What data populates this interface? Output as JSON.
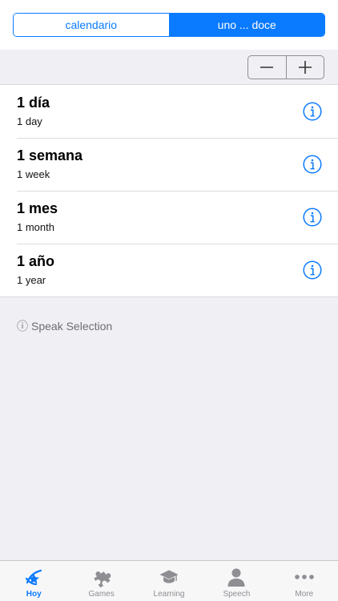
{
  "segmented": {
    "left_label": "calendario",
    "right_label": "uno ... doce",
    "selected": "right"
  },
  "stepper": {
    "minus": "−",
    "plus": "+"
  },
  "list": [
    {
      "title": "1 día",
      "subtitle": "1 day"
    },
    {
      "title": "1 semana",
      "subtitle": "1 week"
    },
    {
      "title": "1 mes",
      "subtitle": "1 month"
    },
    {
      "title": "1 año",
      "subtitle": "1 year"
    }
  ],
  "note": {
    "icon": "ⓘ",
    "text": "Speak Selection"
  },
  "tabbar": [
    {
      "label": "Hoy",
      "icon": "hoy-icon",
      "active": true
    },
    {
      "label": "Games",
      "icon": "puzzle-icon",
      "active": false
    },
    {
      "label": "Learning",
      "icon": "graduation-cap-icon",
      "active": false
    },
    {
      "label": "Speech",
      "icon": "person-icon",
      "active": false
    },
    {
      "label": "More",
      "icon": "more-dots-icon",
      "active": false
    }
  ],
  "colors": {
    "accent": "#0a7aff",
    "inactive": "#8e8e93",
    "background": "#efeff4"
  }
}
